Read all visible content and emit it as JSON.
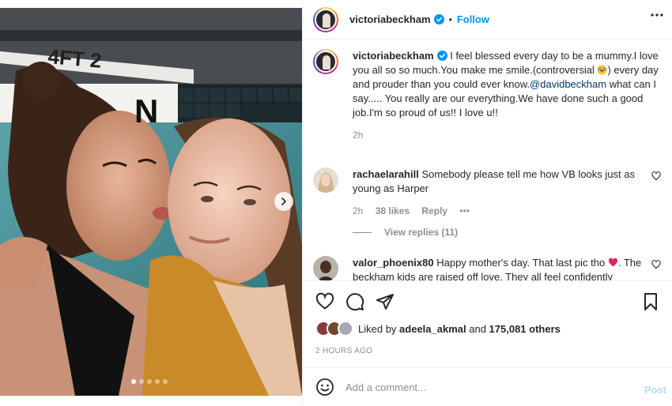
{
  "photo": {
    "pool_marking": "4FT 2",
    "no_diving_fragment": "N",
    "carousel_dots": 5,
    "active_dot": 0
  },
  "header": {
    "username": "victoriabeckham",
    "bullet": "•",
    "follow_label": "Follow"
  },
  "caption": {
    "username": "victoriabeckham",
    "text_part1": " I feel blessed every day to be a mummy.I love you all so so much.You make me smile.(controversial ",
    "text_part2": ") every day and prouder than you could ever know.",
    "mention": "@davidbeckham",
    "text_part3": " what can I say..... You really are our everything.We have done such a good job.I'm so proud of us!! I love u!!",
    "time": "2h"
  },
  "comments": [
    {
      "username": "rachaelarahill",
      "text": " Somebody please tell me how VB looks just as young as Harper",
      "time": "2h",
      "likes": "38 likes",
      "reply_label": "Reply",
      "more": "•••",
      "view_replies": "View replies (11)"
    },
    {
      "username": "valor_phoenix80",
      "text_part1": " Happy mother's day. That last pic tho ",
      "text_part2": ". The beckham kids are raised off love. They all feel confidently"
    }
  ],
  "likes": {
    "prefix": "Liked by ",
    "user": "adeela_akmal",
    "middle": " and ",
    "count": "175,081 others"
  },
  "timestamp": "2 HOURS AGO",
  "composer": {
    "placeholder": "Add a comment...",
    "post_label": "Post"
  },
  "colors": {
    "accent": "#0095f6",
    "text": "#262626",
    "muted": "#8e8e8e",
    "post_disabled": "#b2dffc"
  }
}
